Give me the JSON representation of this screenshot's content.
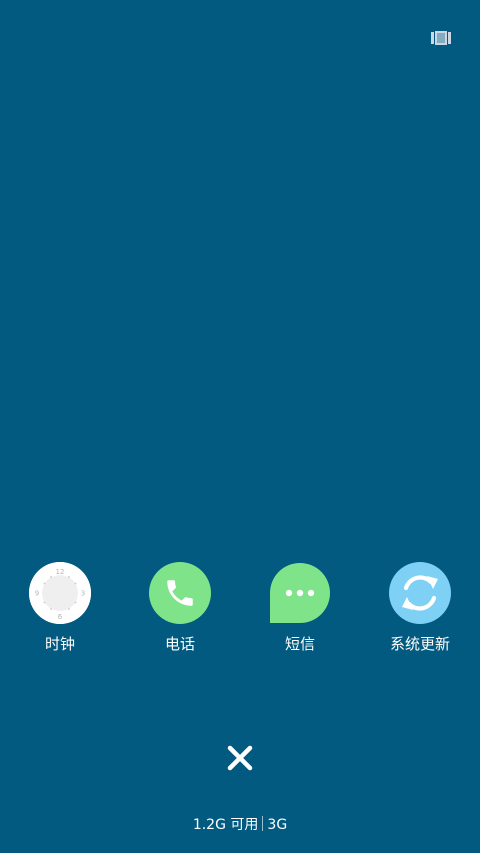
{
  "apps": [
    {
      "label": "时钟",
      "icon": "clock-icon"
    },
    {
      "label": "电话",
      "icon": "phone-icon"
    },
    {
      "label": "短信",
      "icon": "message-icon"
    },
    {
      "label": "系统更新",
      "icon": "update-icon"
    }
  ],
  "clock_numbers": [
    "12",
    "3",
    "6",
    "9"
  ],
  "memory": {
    "available": "1.2G 可用",
    "network": "3G"
  },
  "colors": {
    "background": "#025a80",
    "phone_green": "#7fe38a",
    "message_green": "#7fe38a",
    "update_blue": "#7ed0f5",
    "clock_face": "#ffffff"
  }
}
